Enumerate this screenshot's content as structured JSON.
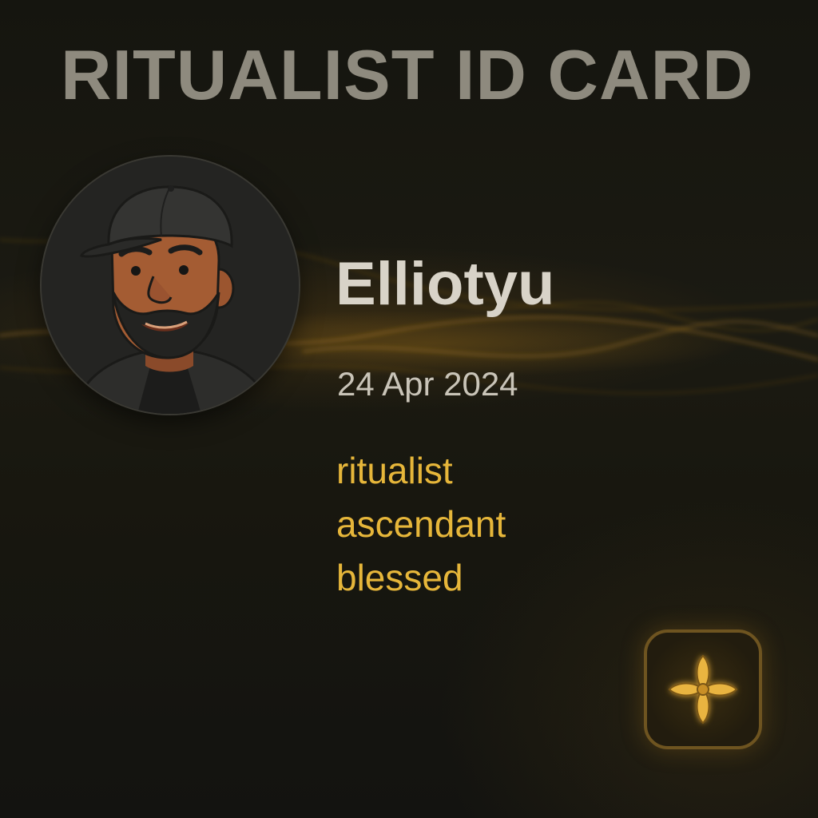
{
  "card": {
    "title": "RITUALIST ID CARD",
    "username": "Elliotyu",
    "date": "24 Apr 2024",
    "tags": [
      "ritualist",
      "ascendant",
      "blessed"
    ],
    "avatar_icon": "bearded-man-in-cap-avatar",
    "emblem_icon": "four-petal-flower-icon"
  },
  "colors": {
    "background": "#141410",
    "title": "#8e8a7e",
    "name": "#d8d3c8",
    "date": "#c9c4b8",
    "tag": "#e6b63a",
    "accent_glow": "#d6961e",
    "emblem_border": "#6e5420",
    "emblem_fill": "#e9b440"
  }
}
